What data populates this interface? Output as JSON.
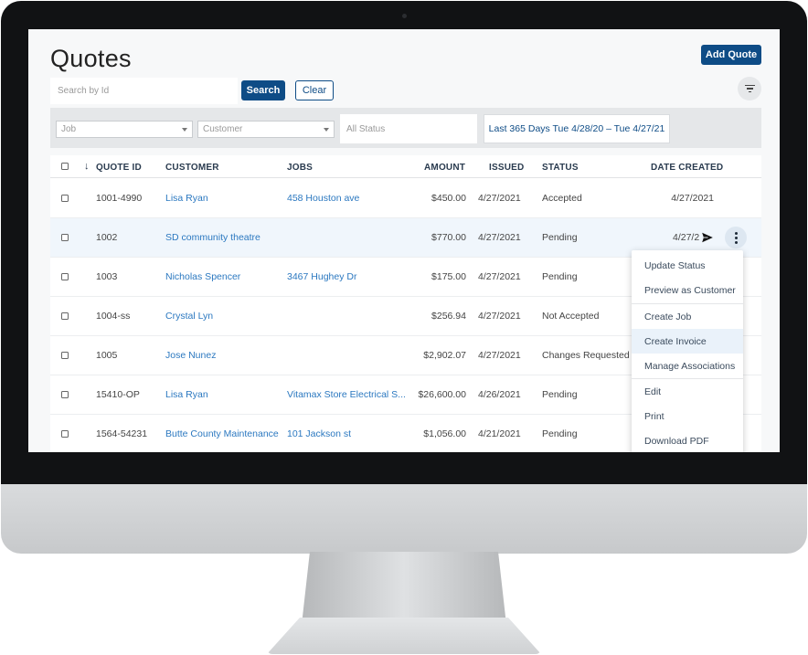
{
  "page": {
    "title": "Quotes"
  },
  "toolbar": {
    "add_label": "Add Quote",
    "search_placeholder": "Search by Id",
    "search_label": "Search",
    "clear_label": "Clear"
  },
  "filters": {
    "job_placeholder": "Job",
    "customer_placeholder": "Customer",
    "status_placeholder": "All Status",
    "date_range": "Last 365 Days Tue 4/28/20 – Tue 4/27/21"
  },
  "table": {
    "columns": {
      "quote_id": "QUOTE ID",
      "customer": "CUSTOMER",
      "jobs": "JOBS",
      "amount": "AMOUNT",
      "issued": "ISSUED",
      "status": "STATUS",
      "date_created": "DATE CREATED"
    },
    "rows": [
      {
        "quote_id": "1001-4990",
        "customer": "Lisa Ryan",
        "jobs": "458 Houston ave",
        "amount": "$450.00",
        "issued": "4/27/2021",
        "status": "Accepted",
        "date_created": "4/27/2021"
      },
      {
        "quote_id": "1002",
        "customer": "SD community theatre",
        "jobs": "",
        "amount": "$770.00",
        "issued": "4/27/2021",
        "status": "Pending",
        "date_created": "4/27/2"
      },
      {
        "quote_id": "1003",
        "customer": "Nicholas Spencer",
        "jobs": "3467 Hughey Dr",
        "amount": "$175.00",
        "issued": "4/27/2021",
        "status": "Pending",
        "date_created": ""
      },
      {
        "quote_id": "1004-ss",
        "customer": "Crystal Lyn",
        "jobs": "",
        "amount": "$256.94",
        "issued": "4/27/2021",
        "status": "Not Accepted",
        "date_created": ""
      },
      {
        "quote_id": "1005",
        "customer": "Jose Nunez",
        "jobs": "",
        "amount": "$2,902.07",
        "issued": "4/27/2021",
        "status": "Changes Requested",
        "date_created": ""
      },
      {
        "quote_id": "15410-OP",
        "customer": "Lisa Ryan",
        "jobs": "Vitamax Store Electrical S...",
        "amount": "$26,600.00",
        "issued": "4/26/2021",
        "status": "Pending",
        "date_created": ""
      },
      {
        "quote_id": "1564-54231",
        "customer": "Butte County Maintenance",
        "jobs": "101 Jackson st",
        "amount": "$1,056.00",
        "issued": "4/21/2021",
        "status": "Pending",
        "date_created": ""
      }
    ]
  },
  "menu": {
    "items": [
      "Update Status",
      "Preview as Customer",
      "Create Job",
      "Create Invoice",
      "Manage Associations",
      "Edit",
      "Print",
      "Download PDF"
    ]
  },
  "colors": {
    "primary": "#0e4c86",
    "link": "#2b78c0",
    "row_highlight": "#f0f6fc"
  }
}
